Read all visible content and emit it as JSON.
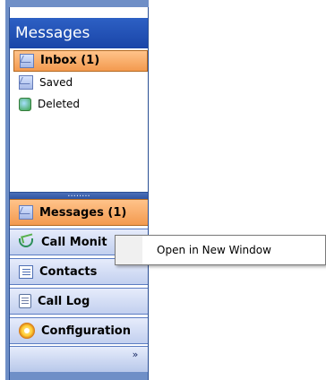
{
  "header": {
    "title": "Messages"
  },
  "folders": [
    {
      "label": "Inbox (1)",
      "icon": "envelope-icon",
      "selected": true
    },
    {
      "label": "Saved",
      "icon": "envelope-icon",
      "selected": false
    },
    {
      "label": "Deleted",
      "icon": "trash-icon",
      "selected": false
    }
  ],
  "splitter": {
    "grip": "........"
  },
  "nav": [
    {
      "label": "Messages (1)",
      "icon": "envelope-icon",
      "active": true
    },
    {
      "label": "Call Monit",
      "icon": "call-monitor-icon",
      "active": false
    },
    {
      "label": "Contacts",
      "icon": "contacts-icon",
      "active": false
    },
    {
      "label": "Call Log",
      "icon": "call-log-icon",
      "active": false
    },
    {
      "label": "Configuration",
      "icon": "configuration-icon",
      "active": false
    }
  ],
  "overflow": {
    "chevron": "»"
  },
  "context_menu": {
    "items": [
      {
        "label": "Open in New Window"
      }
    ]
  },
  "colors": {
    "header_blue": "#1a45a8",
    "selected_orange": "#f39a4f",
    "frame_blue": "#6f8fc7",
    "button_face": "#c2d0ef"
  }
}
